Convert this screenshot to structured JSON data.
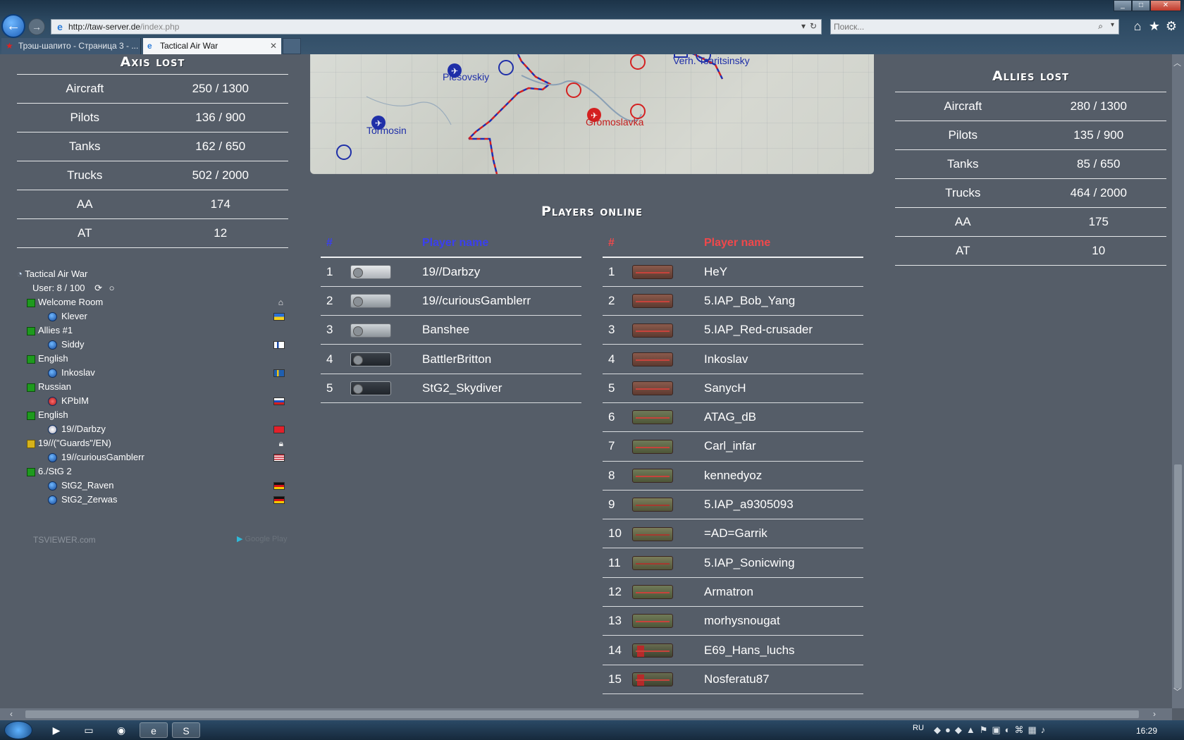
{
  "browser": {
    "address": {
      "host": "http://taw-server.de",
      "path": "/index.php"
    },
    "search_placeholder": "Поиск...",
    "tabs": [
      {
        "label": "Трэш-шапито - Страница 3 - ..."
      },
      {
        "label": "Tactical Air War"
      }
    ]
  },
  "axis_lost": {
    "title": "Axis lost",
    "rows": [
      {
        "label": "Aircraft",
        "value": "250 / 1300"
      },
      {
        "label": "Pilots",
        "value": "136 / 900"
      },
      {
        "label": "Tanks",
        "value": "162 / 650"
      },
      {
        "label": "Trucks",
        "value": "502 / 2000"
      },
      {
        "label": "AA",
        "value": "174"
      },
      {
        "label": "AT",
        "value": "12"
      }
    ]
  },
  "allies_lost": {
    "title": "Allies lost",
    "rows": [
      {
        "label": "Aircraft",
        "value": "280 / 1300"
      },
      {
        "label": "Pilots",
        "value": "135 / 900"
      },
      {
        "label": "Tanks",
        "value": "85 / 650"
      },
      {
        "label": "Trucks",
        "value": "464 / 2000"
      },
      {
        "label": "AA",
        "value": "175"
      },
      {
        "label": "AT",
        "value": "10"
      }
    ]
  },
  "map": {
    "labels": [
      {
        "text": "Plesovskiy",
        "side": "blue"
      },
      {
        "text": "Verh. Tsaritsinsky",
        "side": "blue"
      },
      {
        "text": "Tormosin",
        "side": "blue"
      },
      {
        "text": "Gromoslavka",
        "side": "red"
      }
    ]
  },
  "players_online": {
    "title": "Players online",
    "axis": {
      "header_num": "#",
      "header_name": "Player name",
      "players": [
        {
          "num": "1",
          "name": "19//Darbzy"
        },
        {
          "num": "2",
          "name": "19//curiousGamblerr"
        },
        {
          "num": "3",
          "name": "Banshee"
        },
        {
          "num": "4",
          "name": "BattlerBritton"
        },
        {
          "num": "5",
          "name": "StG2_Skydiver"
        }
      ]
    },
    "allies": {
      "header_num": "#",
      "header_name": "Player name",
      "players": [
        {
          "num": "1",
          "name": "HeY"
        },
        {
          "num": "2",
          "name": "5.IAP_Bob_Yang"
        },
        {
          "num": "3",
          "name": "5.IAP_Red-crusader"
        },
        {
          "num": "4",
          "name": "Inkoslav"
        },
        {
          "num": "5",
          "name": "SanycH"
        },
        {
          "num": "6",
          "name": "ATAG_dB"
        },
        {
          "num": "7",
          "name": "Carl_infar"
        },
        {
          "num": "8",
          "name": "kennedyoz"
        },
        {
          "num": "9",
          "name": "5.IAP_a9305093"
        },
        {
          "num": "10",
          "name": "=AD=Garrik"
        },
        {
          "num": "11",
          "name": "5.IAP_Sonicwing"
        },
        {
          "num": "12",
          "name": "Armatron"
        },
        {
          "num": "13",
          "name": "morhysnougat"
        },
        {
          "num": "14",
          "name": "E69_Hans_luchs"
        },
        {
          "num": "15",
          "name": "Nosferatu87"
        }
      ]
    }
  },
  "ts_viewer": {
    "server_name": "Tactical Air War",
    "users": "User: 8 / 100",
    "channels": [
      {
        "name": "Welcome Room",
        "users": [
          {
            "name": "Klever",
            "flag": "ua"
          }
        ]
      },
      {
        "name": "Allies #1",
        "users": [
          {
            "name": "Siddy",
            "flag": "fi"
          }
        ]
      },
      {
        "name": "English",
        "users": [
          {
            "name": "Inkoslav",
            "flag": "se"
          }
        ]
      },
      {
        "name": "Russian",
        "users": [
          {
            "name": "KPbIM",
            "flag": "ru"
          }
        ]
      },
      {
        "name": "English",
        "users": [
          {
            "name": "19//Darbzy",
            "flag": "hk"
          }
        ]
      },
      {
        "name": "19//(\"Guards\"/EN)",
        "users": [
          {
            "name": "19//curiousGamblerr",
            "flag": "us"
          }
        ]
      },
      {
        "name": "6./StG 2",
        "users": [
          {
            "name": "StG2_Raven",
            "flag": "de"
          },
          {
            "name": "StG2_Zerwas",
            "flag": "de"
          }
        ]
      }
    ],
    "footer": "TSVIEWER.com",
    "badge": "Google Play"
  },
  "taskbar": {
    "lang": "RU",
    "clock": "16:29"
  }
}
